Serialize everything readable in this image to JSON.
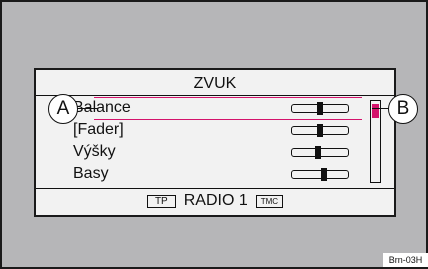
{
  "screen": {
    "title": "ZVUK",
    "menu_items": [
      {
        "label": "Balance",
        "selected": true,
        "slider_level": 0.5
      },
      {
        "label": "[Fader]",
        "selected": false,
        "slider_level": 0.5
      },
      {
        "label": "Výšky",
        "selected": false,
        "slider_level": 0.46
      },
      {
        "label": "Basy",
        "selected": false,
        "slider_level": 0.58
      }
    ],
    "scroll_position": 0.05,
    "status": {
      "tp_label": "TP",
      "station": "RADIO 1",
      "tmc_label": "TMC"
    }
  },
  "callouts": {
    "a": "A",
    "b": "B"
  },
  "figure_code": "Brn-03H",
  "colors": {
    "accent": "#d4136c",
    "frame_bg": "#b6b6b8",
    "screen_bg": "#f2f2f2"
  }
}
